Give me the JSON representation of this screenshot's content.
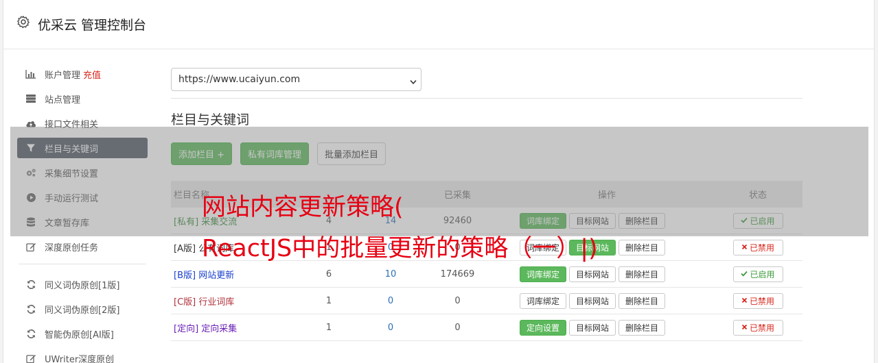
{
  "app": {
    "title": "优采云 管理控制台"
  },
  "sidebar": {
    "items": [
      {
        "label": "账户管理",
        "extra": "充值",
        "icon": "bar-chart-icon"
      },
      {
        "label": "站点管理",
        "icon": "server-icon"
      },
      {
        "label": "接口文件相关",
        "icon": "cloud-upload-icon"
      },
      {
        "label": "栏目与关键词",
        "icon": "filter-icon",
        "active": true
      },
      {
        "label": "采集细节设置",
        "icon": "gears-icon"
      },
      {
        "label": "手动运行测试",
        "icon": "play-circle-icon"
      },
      {
        "label": "文章暂存库",
        "icon": "database-icon"
      },
      {
        "label": "深度原创任务",
        "icon": "edit-icon"
      }
    ],
    "items2": [
      {
        "label": "同义词伪原创[1版]",
        "icon": "refresh-icon"
      },
      {
        "label": "同义词伪原创[2版]",
        "icon": "refresh-icon"
      },
      {
        "label": "智能伪原创[AI版]",
        "icon": "refresh-icon"
      },
      {
        "label": "UWriter深度原创",
        "icon": "edit-icon"
      }
    ]
  },
  "site_select": {
    "value": "https://www.ucaiyun.com"
  },
  "section": {
    "title": "栏目与关键词"
  },
  "toolbar": {
    "add_label": "添加栏目 +",
    "private_lib_label": "私有词库管理",
    "batch_add_label": "批量添加栏目"
  },
  "table": {
    "headers": {
      "name": "栏目名称",
      "col2": "",
      "col3": "",
      "collected": "已采集",
      "ops": "操作",
      "status": "状态"
    },
    "rows": [
      {
        "name": "[私有] 采集交流",
        "name_color": "#3c8a3c",
        "n1": "4",
        "n2": "14",
        "n3": "92460",
        "op1": "词库绑定",
        "op1_green": true,
        "op2": "目标网站",
        "op2_green": false,
        "op3": "删除栏目",
        "status": "已启用",
        "on": true
      },
      {
        "name": "[A版] 公有词库",
        "name_color": "#333333",
        "n1": "1",
        "n2": "0",
        "n3": "0",
        "op1": "词库绑定",
        "op1_green": false,
        "op2": "目标网站",
        "op2_green": true,
        "op3": "删除栏目",
        "status": "已禁用",
        "on": false
      },
      {
        "name": "[B版] 网站更新",
        "name_color": "#1a3fcc",
        "n1": "6",
        "n2": "10",
        "n3": "174669",
        "op1": "词库绑定",
        "op1_green": true,
        "op2": "目标网站",
        "op2_green": false,
        "op3": "删除栏目",
        "status": "已启用",
        "on": true
      },
      {
        "name": "[C版] 行业词库",
        "name_color": "#b0303a",
        "n1": "1",
        "n2": "0",
        "n3": "0",
        "op1": "词库绑定",
        "op1_green": false,
        "op2": "目标网站",
        "op2_green": false,
        "op3": "删除栏目",
        "status": "已禁用",
        "on": false
      },
      {
        "name": "[定向] 定向采集",
        "name_color": "#6a1fb5",
        "n1": "1",
        "n2": "0",
        "n3": "0",
        "op1": "定向设置",
        "op1_green": true,
        "op2": "目标网站",
        "op2_green": false,
        "op3": "删除栏目",
        "status": "已禁用",
        "on": false
      }
    ]
  },
  "overlay": {
    "line1": "网站内容更新策略(",
    "line2": "ReactJS中的批量更新的策略（一）|)"
  }
}
